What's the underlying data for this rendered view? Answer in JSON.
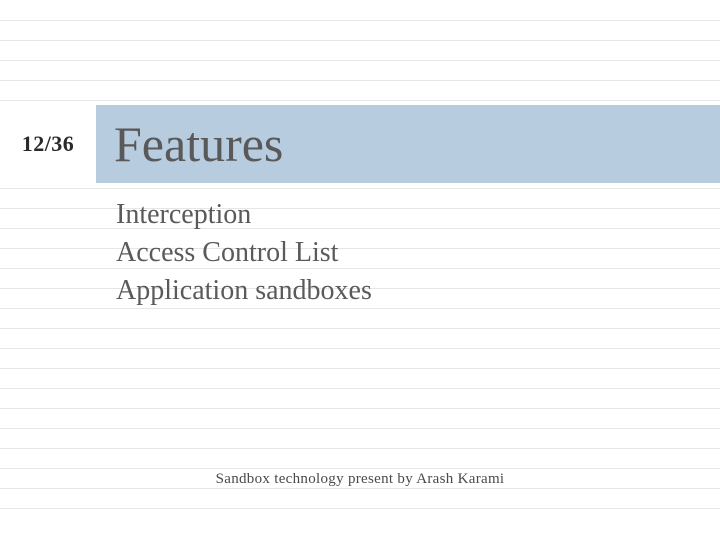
{
  "slide": {
    "page_number": "12/36",
    "title": "Features",
    "bullets": [
      "Interception",
      "Access Control List",
      "Application sandboxes"
    ],
    "footer": "Sandbox technology present by Arash Karami"
  },
  "colors": {
    "title_bg": "#b8cce0",
    "text": "#595959",
    "line": "#e6e6e6"
  }
}
